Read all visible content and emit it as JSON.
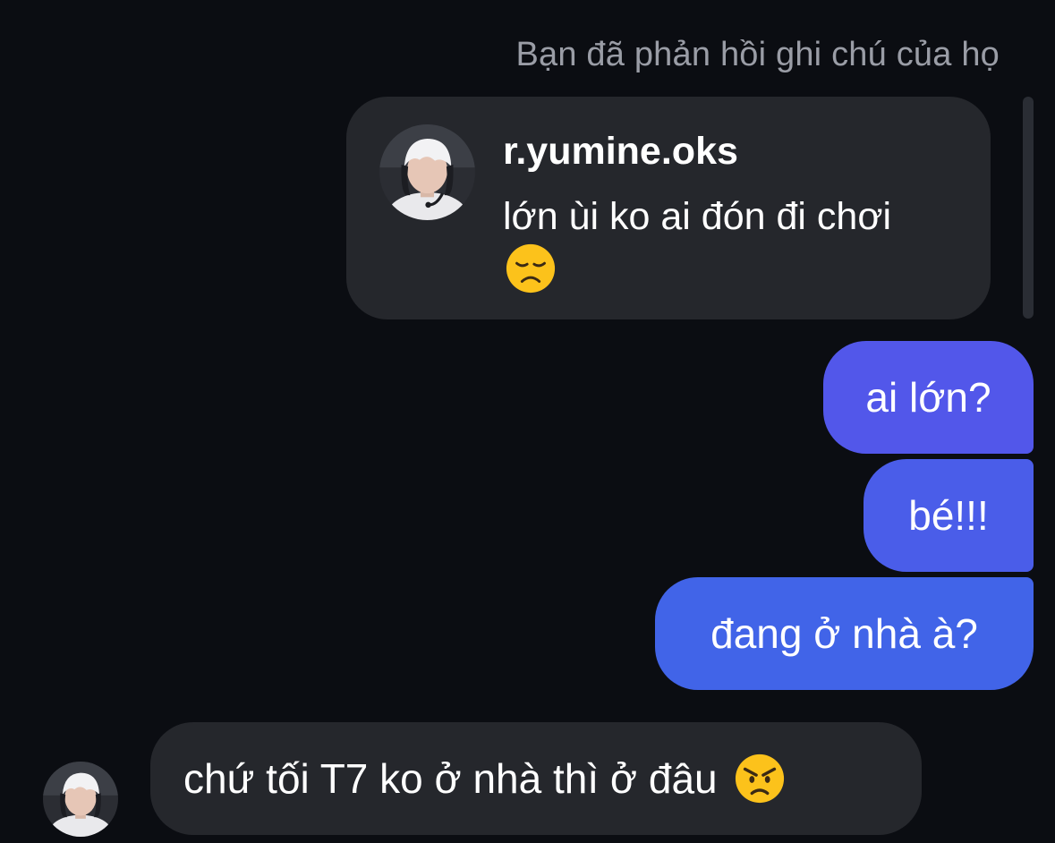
{
  "header": {
    "reply_label": "Bạn đã phản hồi ghi chú của họ"
  },
  "note": {
    "username": "r.yumine.oks",
    "text": "lớn ùi ko ai đón đi chơi",
    "emoji": "disappointed-face-icon"
  },
  "messages": {
    "outgoing": [
      "ai lớn?",
      "bé!!!",
      "đang ở nhà à?"
    ],
    "incoming": {
      "text": "chứ tối T7 ko ở nhà thì ở đâu",
      "emoji": "angry-face-icon"
    }
  },
  "colors": {
    "background": "#0b0d12",
    "note_card": "#25272c",
    "outgoing_1": "#5257ea",
    "outgoing_2": "#4a5de9",
    "outgoing_3": "#4164e8",
    "incoming": "#25272c",
    "secondary_text": "#9a9da6"
  }
}
